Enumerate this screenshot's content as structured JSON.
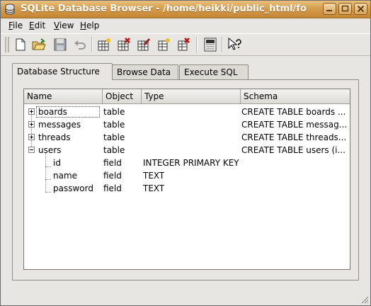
{
  "window": {
    "title": "SQLite Database Browser - /home/heikki/public_html/fo"
  },
  "menubar": {
    "items": [
      {
        "label": "File",
        "accel": "F"
      },
      {
        "label": "Edit",
        "accel": "E"
      },
      {
        "label": "View",
        "accel": "V"
      },
      {
        "label": "Help",
        "accel": "H"
      }
    ]
  },
  "toolbar": {
    "buttons": [
      "new-database-icon",
      "open-database-icon",
      "save-icon",
      "undo-icon",
      "create-table-icon",
      "delete-table-icon",
      "modify-table-icon",
      "create-index-icon",
      "delete-index-icon",
      "log-window-icon",
      "whats-this-icon"
    ]
  },
  "tabs": [
    {
      "label": "Database Structure",
      "active": true
    },
    {
      "label": "Browse Data",
      "active": false
    },
    {
      "label": "Execute SQL",
      "active": false
    }
  ],
  "structure": {
    "columns": [
      "Name",
      "Object",
      "Type",
      "Schema"
    ],
    "rows": [
      {
        "name": "boards",
        "object": "table",
        "type": "",
        "schema": "CREATE TABLE boards ..."
      },
      {
        "name": "messages",
        "object": "table",
        "type": "",
        "schema": "CREATE TABLE messag..."
      },
      {
        "name": "threads",
        "object": "table",
        "type": "",
        "schema": "CREATE TABLE threads..."
      },
      {
        "name": "users",
        "object": "table",
        "type": "",
        "schema": "CREATE TABLE users (i..."
      },
      {
        "name": "id",
        "object": "field",
        "type": "INTEGER PRIMARY KEY",
        "schema": ""
      },
      {
        "name": "name",
        "object": "field",
        "type": "TEXT",
        "schema": ""
      },
      {
        "name": "password",
        "object": "field",
        "type": "TEXT",
        "schema": ""
      }
    ]
  },
  "colors": {
    "titlebar": "#d49a4a",
    "background": "#e8e6e2"
  }
}
